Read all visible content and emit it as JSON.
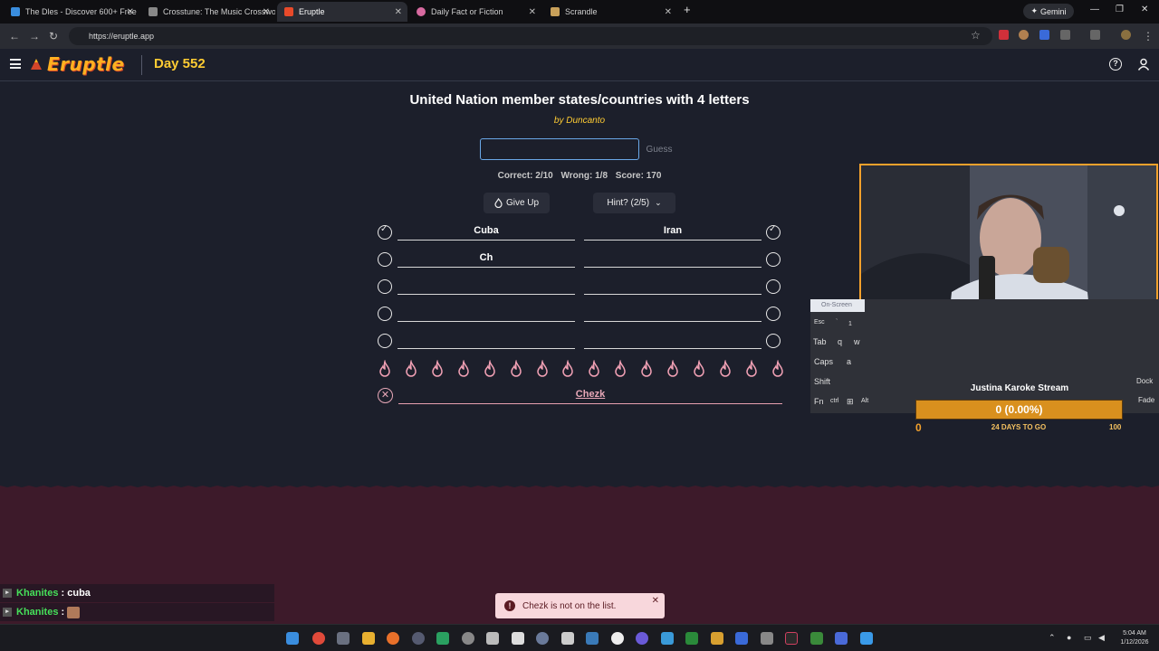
{
  "browser": {
    "tabs": [
      {
        "title": "The Dles - Discover 600+ Free I",
        "favicon_color": "#3a8dde",
        "active": false
      },
      {
        "title": "Crosstune: The Music Crosswor",
        "favicon_color": "#888888",
        "active": false
      },
      {
        "title": "Eruptle",
        "favicon_color": "#e84a2a",
        "active": true
      },
      {
        "title": "Daily Fact or Fiction",
        "favicon_color": "#d86aa0",
        "active": false
      },
      {
        "title": "Scrandle",
        "favicon_color": "#c8a05a",
        "active": false
      }
    ],
    "gemini_label": "Gemini",
    "url": "https://eruptle.app"
  },
  "header": {
    "logo": "Eruptle",
    "day": "Day 552"
  },
  "game": {
    "title": "United Nation member states/countries with 4 letters",
    "byline": "by Duncanto",
    "input_value": "",
    "guess_button": "Guess",
    "stats": {
      "correct": "Correct: 2/10",
      "wrong": "Wrong: 1/8",
      "score": "Score: 170"
    },
    "give_up": "Give Up",
    "hint": "Hint? (2/5)",
    "rows": [
      {
        "left": "Cuba",
        "left_checked": true,
        "right": "Iran",
        "right_checked": true
      },
      {
        "left": "Ch",
        "left_checked": false,
        "right": "",
        "right_checked": false
      },
      {
        "left": "",
        "left_checked": false,
        "right": "",
        "right_checked": false
      },
      {
        "left": "",
        "left_checked": false,
        "right": "",
        "right_checked": false
      },
      {
        "left": "",
        "left_checked": false,
        "right": "",
        "right_checked": false
      }
    ],
    "wrong_guess": "Chezk",
    "toast": "Chezk is not on the list."
  },
  "stream": {
    "keyboard_title": "On-Screen",
    "karaoke_title": "Justina Karoke Stream",
    "bar_text": "0 (0.00%)",
    "bar_min": "0",
    "bar_days": "24 DAYS TO GO",
    "bar_max": "100",
    "chat": [
      {
        "name": "Khanites",
        "msg": "cuba"
      },
      {
        "name": "Khanites",
        "msg": ""
      }
    ]
  },
  "taskbar": {
    "time": "5:04 AM",
    "date": "1/12/2026"
  },
  "colors": {
    "accent": "#ffcc33",
    "background": "#1c1f2b",
    "lava": "#3d1a2a",
    "flame": "#f0a0b4"
  }
}
